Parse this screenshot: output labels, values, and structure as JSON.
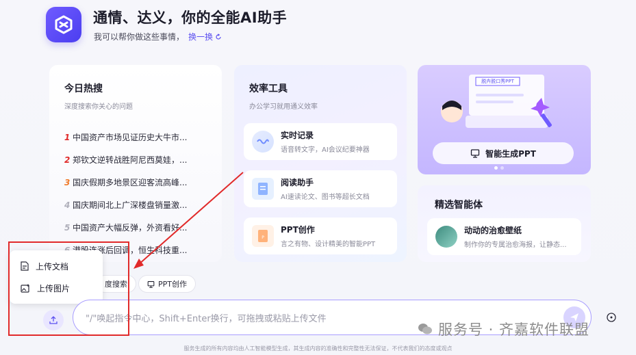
{
  "header": {
    "title": "通情、达义，你的全能AI助手",
    "subtitle": "我可以帮你做这些事情，",
    "switch_label": "换一换"
  },
  "hot": {
    "title": "今日热搜",
    "subtitle": "深度搜索你关心的问题",
    "items": [
      {
        "num": "1",
        "text": "中国资产市场见证历史大牛市..."
      },
      {
        "num": "2",
        "text": "郑钦文逆转战胜阿尼西莫娃，..."
      },
      {
        "num": "3",
        "text": "国庆假期多地景区迎客流高峰..."
      },
      {
        "num": "4",
        "text": "国庆期间北上广深楼盘销量激..."
      },
      {
        "num": "5",
        "text": "中国资产大幅反弹，外资看好..."
      },
      {
        "num": "6",
        "text": "港股连涨后回调，恒生科技重..."
      }
    ],
    "num_colors": [
      "#e02a2a",
      "#e02a2a",
      "#f07a2a",
      "#b0b0bb",
      "#b0b0bb",
      "#b0b0bb"
    ]
  },
  "tools": {
    "title": "效率工具",
    "subtitle": "办公学习就用通义效率",
    "items": [
      {
        "title": "实时记录",
        "desc": "语音转文字，AI会议纪要神器",
        "icon": "waveform-icon"
      },
      {
        "title": "阅读助手",
        "desc": "AI速读论文、图书等超长文档",
        "icon": "document-reader-icon"
      },
      {
        "title": "PPT创作",
        "desc": "言之有物、设计精美的智能PPT",
        "icon": "ppt-file-icon"
      }
    ]
  },
  "ppt_banner": {
    "slide_caption": "脱卉脱口秀PPT",
    "button_label": "智能生成PPT"
  },
  "agents": {
    "title": "精选智能体",
    "item_title": "动动的治愈壁纸",
    "item_desc": "制作你的专属治愈海报，让静态..."
  },
  "popover": {
    "items": [
      {
        "label": "上传文档",
        "icon": "document-icon"
      },
      {
        "label": "上传图片",
        "icon": "image-icon"
      }
    ]
  },
  "chips": {
    "search": "度搜索",
    "ppt": "PPT创作"
  },
  "input": {
    "placeholder": "\"/\"唤起指令中心，Shift+Enter换行，可拖拽或粘贴上传文件"
  },
  "watermark": "服务号 · 齐嘉软件联盟",
  "footer": "服务生成的所有内容均由人工智能模型生成，其生成内容的准确性和完整性无法保证，不代表我们的态度或观点",
  "colors": {
    "accent": "#5b4ff0",
    "annotation_red": "#e12a2a"
  }
}
